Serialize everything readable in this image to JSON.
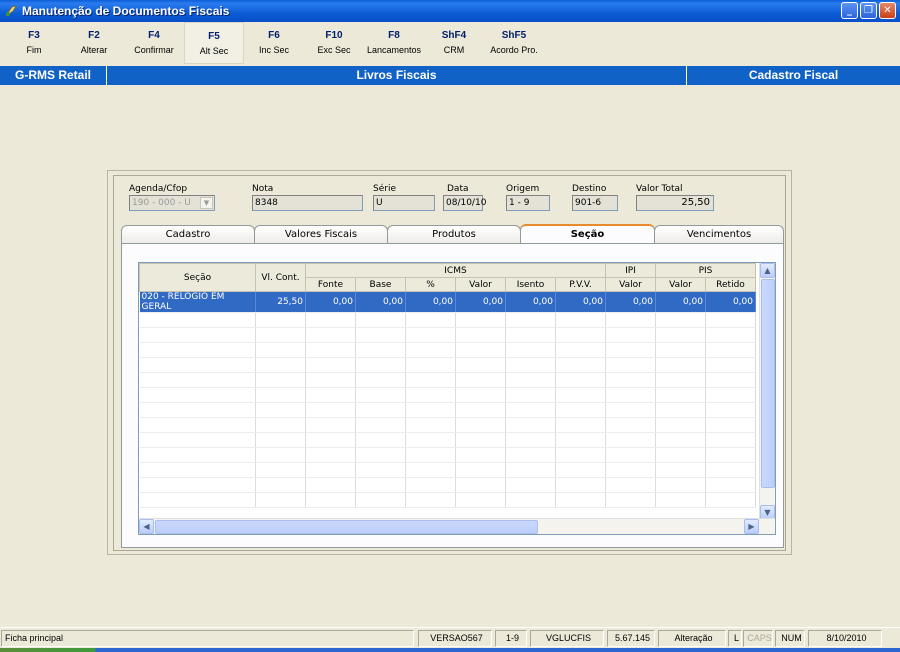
{
  "window": {
    "title": "Manutenção de Documentos Fiscais",
    "buttons": [
      "minimize",
      "restore",
      "close"
    ]
  },
  "toolbar": {
    "keys": [
      {
        "key": "F3",
        "label": "Fim"
      },
      {
        "key": "F2",
        "label": "Alterar"
      },
      {
        "key": "F4",
        "label": "Confirmar"
      },
      {
        "key": "F5",
        "label": "Alt Sec"
      },
      {
        "key": "F6",
        "label": "Inc Sec"
      },
      {
        "key": "F10",
        "label": "Exc Sec"
      },
      {
        "key": "F8",
        "label": "Lancamentos"
      },
      {
        "key": "ShF4",
        "label": "CRM"
      },
      {
        "key": "ShF5",
        "label": "Acordo Pro."
      }
    ]
  },
  "header": {
    "left": "G-RMS Retail",
    "center": "Livros Fiscais",
    "right": "Cadastro Fiscal"
  },
  "fields": {
    "agenda": {
      "label": "Agenda/Cfop",
      "value": "190 - 000 - U"
    },
    "nota": {
      "label": "Nota",
      "value": "8348"
    },
    "serie": {
      "label": "Série",
      "value": "U"
    },
    "data": {
      "label": "Data",
      "value": "08/10/10"
    },
    "origem": {
      "label": "Origem",
      "value": "1 - 9"
    },
    "destino": {
      "label": "Destino",
      "value": "901-6"
    },
    "valor_total": {
      "label": "Valor Total",
      "value": "25,50"
    }
  },
  "tabs": [
    {
      "label": "Cadastro"
    },
    {
      "label": "Valores Fiscais"
    },
    {
      "label": "Produtos"
    },
    {
      "label": "Seção"
    },
    {
      "label": "Vencimentos"
    }
  ],
  "grid": {
    "group_headers": {
      "icms": "ICMS",
      "ipi": "IPI",
      "pis": "PIS"
    },
    "col_secao": "Seção",
    "col_vlcont": "Vl. Cont.",
    "sub_headers": [
      "Fonte",
      "Base",
      "%",
      "Valor",
      "Isento",
      "P.V.V.",
      "Valor",
      "Valor",
      "Retido"
    ],
    "rows": [
      [
        "020 - RELOGIO EM GERAL",
        "25,50",
        "0,00",
        "0,00",
        "0,00",
        "0,00",
        "0,00",
        "0,00",
        "0,00",
        "0,00",
        "0,00"
      ]
    ]
  },
  "statusbar": {
    "left": "Ficha principal",
    "version": "VERSAO567",
    "range": "1-9",
    "program": "VGLUCFIS",
    "build": "5.67.145",
    "mode": "Alteração",
    "l": "L",
    "caps": "CAPS",
    "num": "NUM",
    "date": "8/10/2010"
  },
  "colors": {
    "titlebar": "#0C5CD6",
    "header": "#1162C7",
    "selected_row": "#316AC5",
    "tab_highlight": "#E68B2C"
  }
}
